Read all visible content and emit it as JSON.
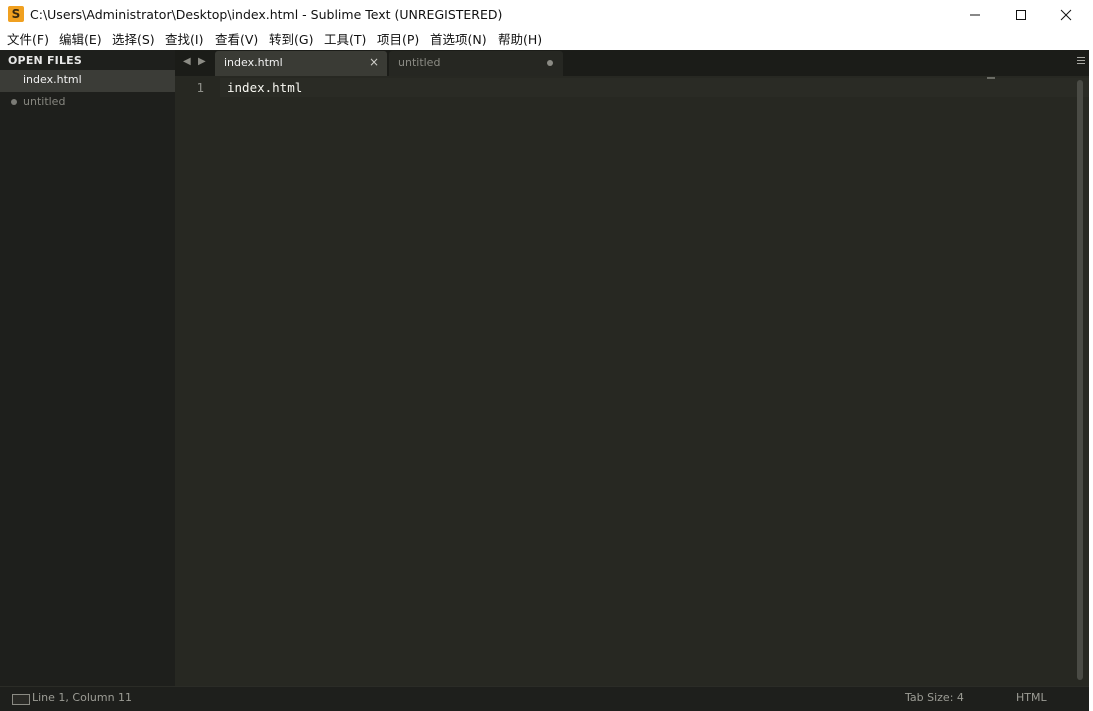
{
  "window": {
    "title": "C:\\Users\\Administrator\\Desktop\\index.html - Sublime Text (UNREGISTERED)",
    "app_icon": "sublime-text-icon",
    "app_icon_letter": "S",
    "minimize_icon": "minimize-icon",
    "maximize_icon": "maximize-icon",
    "close_icon": "close-icon"
  },
  "menu": {
    "items": [
      "文件(F)",
      "编辑(E)",
      "选择(S)",
      "查找(I)",
      "查看(V)",
      "转到(G)",
      "工具(T)",
      "项目(P)",
      "首选项(N)",
      "帮助(H)"
    ]
  },
  "sidebar": {
    "header": "OPEN FILES",
    "files": [
      {
        "label": "index.html",
        "active": true,
        "modified": false
      },
      {
        "label": "untitled",
        "active": false,
        "modified": true
      }
    ]
  },
  "tabs": {
    "nav_left": "◀",
    "nav_right": "▶",
    "items": [
      {
        "label": "index.html",
        "active": true,
        "close": "×"
      },
      {
        "label": "untitled",
        "active": false,
        "modified": true
      }
    ],
    "menu_icon": "hamburger-icon"
  },
  "editor": {
    "lines": [
      {
        "number": "1",
        "text": "index.html"
      }
    ]
  },
  "status": {
    "position": "Line 1, Column 11",
    "tab_size": "Tab Size: 4",
    "syntax": "HTML",
    "console_icon": "console-icon"
  },
  "colors": {
    "editor_bg": "#272822",
    "sidebar_bg": "#1e1f1c",
    "accent_icon": "#f0a020"
  }
}
